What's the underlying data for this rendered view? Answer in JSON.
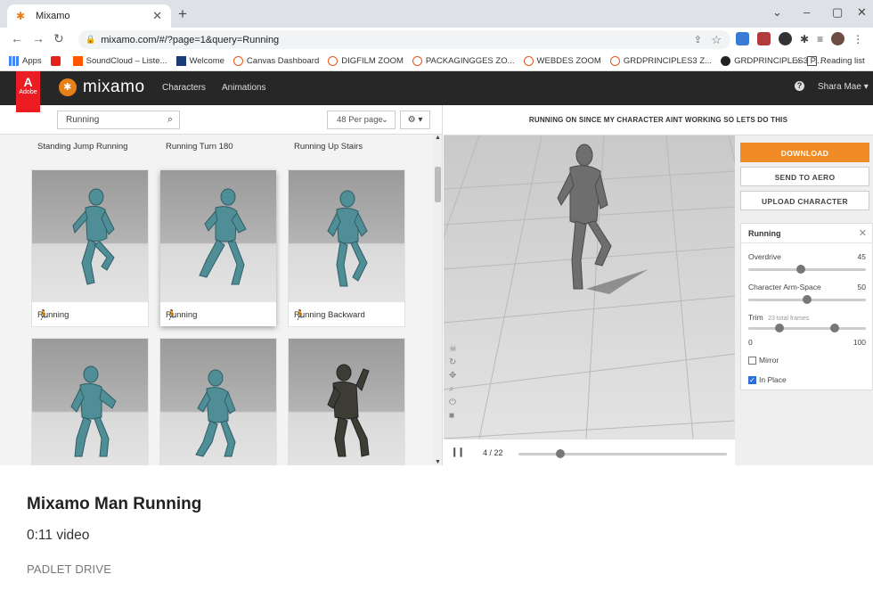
{
  "browser": {
    "tab_title": "Mixamo",
    "new_tab": "+",
    "url": "mixamo.com/#/?page=1&query=Running",
    "window_controls": [
      "⌄",
      "–",
      "▢",
      "✕"
    ],
    "bookmarks": [
      {
        "label": "Apps",
        "icon": "apps-grid-icon"
      },
      {
        "label": "",
        "icon": "youtube-icon"
      },
      {
        "label": "SoundCloud – Liste...",
        "icon": "soundcloud-icon"
      },
      {
        "label": "Welcome",
        "icon": "welcome-icon"
      },
      {
        "label": "Canvas Dashboard",
        "icon": "canvas-icon"
      },
      {
        "label": "DIGFILM ZOOM",
        "icon": "canvas-icon"
      },
      {
        "label": "PACKAGINGGES ZO...",
        "icon": "canvas-icon"
      },
      {
        "label": "WEBDES ZOOM",
        "icon": "canvas-icon"
      },
      {
        "label": "GRDPRINCIPLES3 Z...",
        "icon": "canvas-icon"
      },
      {
        "label": "GRDPRINCIPLES3 P...",
        "icon": "dark-circle-icon"
      }
    ],
    "bookmarks_more": "»",
    "reading_list": "Reading list"
  },
  "mixamo": {
    "adobe_label": "Adobe",
    "logo_text": "mixamo",
    "nav": [
      "Characters",
      "Animations"
    ],
    "user": "Shara Mae ▾",
    "search_value": "Running",
    "per_page": "48 Per page",
    "gear_label": "⚙ ▾",
    "top_labels": [
      "Standing Jump Running",
      "Running Turn 180",
      "Running Up Stairs"
    ],
    "cards": [
      {
        "label": "Running"
      },
      {
        "label": "Running"
      },
      {
        "label": "Running Backward"
      },
      {
        "label": ""
      },
      {
        "label": ""
      },
      {
        "label": ""
      }
    ],
    "viewport_title": "RUNNING ON SINCE MY CHARACTER AINT WORKING SO LETS DO THIS",
    "frame_text": "4 / 22",
    "progress": 0.2,
    "buttons": {
      "download": "DOWNLOAD",
      "send": "SEND TO AERO",
      "upload": "UPLOAD CHARACTER"
    },
    "settings": {
      "title": "Running",
      "overdrive_label": "Overdrive",
      "overdrive_value": "45",
      "overdrive_frac": 0.45,
      "armspace_label": "Character Arm-Space",
      "armspace_value": "50",
      "armspace_frac": 0.5,
      "trim_label": "Trim",
      "trim_note": "23 total frames",
      "trim_min": "0",
      "trim_max": "100",
      "mirror_label": "Mirror",
      "mirror_checked": false,
      "inplace_label": "In Place",
      "inplace_checked": true
    }
  },
  "caption": {
    "title": "Mixamo Man Running",
    "subtitle": "0:11 video",
    "source": "PADLET DRIVE"
  }
}
